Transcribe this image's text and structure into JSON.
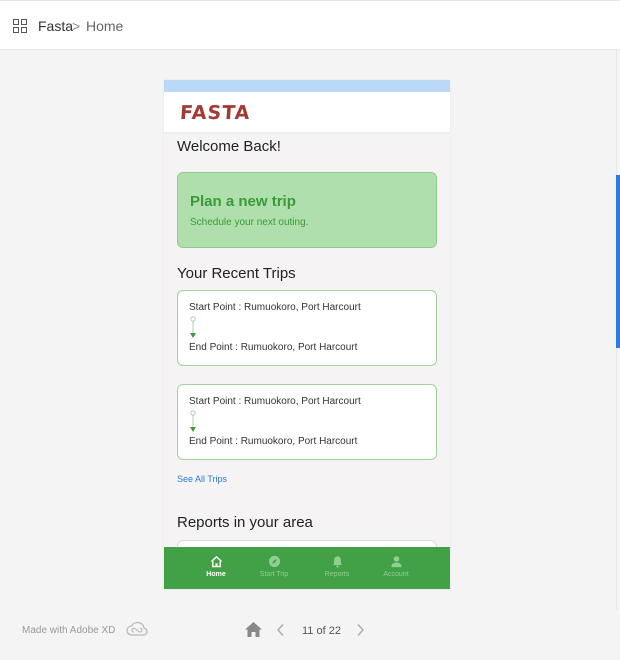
{
  "topbar": {
    "app_name": "Fasta",
    "separator": ">",
    "page_name": "Home",
    "icon": "grid-icon"
  },
  "app": {
    "logo_text": "FASTA",
    "welcome": "Welcome Back!",
    "plan_card": {
      "title": "Plan a new trip",
      "subtitle": "Schedule your next outing."
    },
    "recent_title": "Your Recent Trips",
    "trips": [
      {
        "start": "Start Point : Rumuokoro, Port Harcourt",
        "end": "End Point : Rumuokoro, Port Harcourt"
      },
      {
        "start": "Start Point : Rumuokoro, Port Harcourt",
        "end": "End Point : Rumuokoro, Port Harcourt"
      }
    ],
    "see_all": "See All Trips",
    "reports_title": "Reports in your area",
    "nav": [
      {
        "label": "Home",
        "icon": "home-icon",
        "active": true
      },
      {
        "label": "Start Trip",
        "icon": "compass-icon",
        "active": false
      },
      {
        "label": "Reports",
        "icon": "bell-icon",
        "active": false
      },
      {
        "label": "Account",
        "icon": "user-icon",
        "active": false
      }
    ]
  },
  "footer": {
    "made_with": "Made with Adobe XD",
    "page_indicator": "11 of 22"
  },
  "colors": {
    "brand_red": "#a33a36",
    "primary_green": "#42a047",
    "card_green": "#afdfad",
    "link_blue": "#2a7ad8",
    "status_blue": "#b9d9f6"
  }
}
